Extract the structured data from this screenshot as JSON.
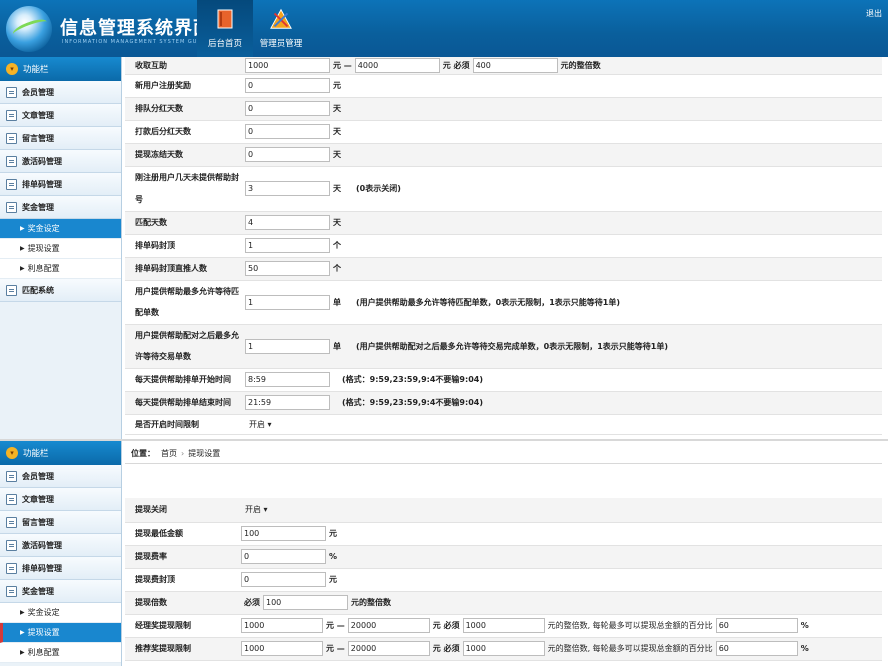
{
  "header": {
    "title": "信息管理系统界面",
    "subtitle": "INFORMATION MANAGEMENT SYSTEM GUI",
    "logout": "退出",
    "nav": [
      {
        "label": "后台首页",
        "icon": "book-icon"
      },
      {
        "label": "管理员管理",
        "icon": "tools-icon"
      }
    ]
  },
  "sidebar": {
    "head": "功能栏",
    "items": [
      "会员管理",
      "文章管理",
      "留言管理",
      "激活码管理",
      "排单码管理",
      "奖金管理"
    ],
    "subs": [
      "奖金设定",
      "提现设置",
      "利息配置"
    ],
    "extra": "匹配系统"
  },
  "form1": {
    "rows": [
      {
        "label": "收取互助",
        "v1": "1000",
        "u1": "元 —",
        "v2": "4000",
        "u2": "元 必须",
        "v3": "400",
        "u3": "元的整倍数"
      },
      {
        "label": "新用户注册奖励",
        "v1": "0",
        "u1": "元"
      },
      {
        "label": "排队分红天数",
        "v1": "0",
        "u1": "天"
      },
      {
        "label": "打款后分红天数",
        "v1": "0",
        "u1": "天"
      },
      {
        "label": "提现冻结天数",
        "v1": "0",
        "u1": "天"
      },
      {
        "label": "刚注册用户几天未提供帮助封号",
        "v1": "3",
        "u1": "天",
        "hint": "(0表示关闭)"
      },
      {
        "label": "匹配天数",
        "v1": "4",
        "u1": "天"
      },
      {
        "label": "排单码封顶",
        "v1": "1",
        "u1": "个"
      },
      {
        "label": "排单码封顶直推人数",
        "v1": "50",
        "u1": "个"
      },
      {
        "label": "用户提供帮助最多允许等待匹配单数",
        "v1": "1",
        "u1": "单",
        "hint": "(用户提供帮助最多允许等待匹配单数，0表示无限制，1表示只能等待1单)"
      },
      {
        "label": "用户提供帮助配对之后最多允许等待交易单数",
        "v1": "1",
        "u1": "单",
        "hint": "(用户提供帮助配对之后最多允许等待交易完成单数，0表示无限制，1表示只能等待1单)"
      },
      {
        "label": "每天提供帮助排单开始时间",
        "v1": "8:59",
        "hint": "(格式：9:59,23:59,9:4不要输9:04)"
      },
      {
        "label": "每天提供帮助排单结束时间",
        "v1": "21:59",
        "hint": "(格式：9:59,23:59,9:4不要输9:04)"
      }
    ],
    "time_limit": {
      "label": "是否开启时间限制",
      "value": "开启"
    }
  },
  "breadcrumb": {
    "label": "位置：",
    "home": "首页",
    "current": "提现设置"
  },
  "form2": {
    "switch": {
      "label": "提现关闭",
      "value": "开启"
    },
    "rows": [
      {
        "label": "提现最低金额",
        "v1": "100",
        "u1": "元"
      },
      {
        "label": "提现费率",
        "v1": "0",
        "u1": "%"
      },
      {
        "label": "提现费封顶",
        "v1": "0",
        "u1": "元"
      }
    ],
    "multiple": {
      "label": "提现倍数",
      "pre": "必须",
      "v1": "100",
      "u1": "元的整倍数"
    },
    "ranges": [
      {
        "label": "经理奖提现限制",
        "v1": "1000",
        "u1": "元 —",
        "v2": "20000",
        "u2": "元 必须",
        "v3": "1000",
        "u3": "元的整倍数, 每轮最多可以提现总金额的百分比",
        "v4": "60",
        "u4": "%"
      },
      {
        "label": "推荐奖提现限制",
        "v1": "1000",
        "u1": "元 —",
        "v2": "20000",
        "u2": "元 必须",
        "v3": "1000",
        "u3": "元的整倍数, 每轮最多可以提现总金额的百分比",
        "v4": "60",
        "u4": "%"
      }
    ]
  }
}
